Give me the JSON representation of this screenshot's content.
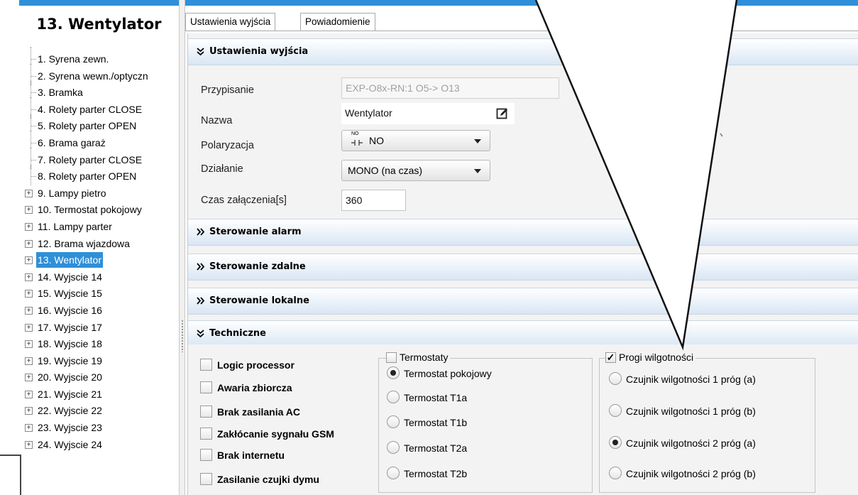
{
  "sidebar": {
    "title": "13. Wentylator",
    "items": [
      {
        "label": "1. Syrena zewn.",
        "expandable": false
      },
      {
        "label": "2. Syrena wewn./optyczn",
        "expandable": false
      },
      {
        "label": "3. Bramka",
        "expandable": false
      },
      {
        "label": "4. Rolety parter CLOSE",
        "expandable": false
      },
      {
        "label": "5. Rolety parter OPEN",
        "expandable": false
      },
      {
        "label": "6. Brama garaż",
        "expandable": false
      },
      {
        "label": "7. Rolety parter CLOSE",
        "expandable": false
      },
      {
        "label": "8. Rolety parter OPEN",
        "expandable": false
      },
      {
        "label": "9. Lampy pietro",
        "expandable": true
      },
      {
        "label": "10. Termostat pokojowy",
        "expandable": true
      },
      {
        "label": "11. Lampy parter",
        "expandable": true
      },
      {
        "label": "12. Brama wjazdowa",
        "expandable": true
      },
      {
        "label": "13. Wentylator",
        "expandable": true,
        "selected": true
      },
      {
        "label": "14. Wyjscie 14",
        "expandable": true
      },
      {
        "label": "15. Wyjscie 15",
        "expandable": true
      },
      {
        "label": "16. Wyjscie 16",
        "expandable": true
      },
      {
        "label": "17. Wyjscie 17",
        "expandable": true
      },
      {
        "label": "18. Wyjscie 18",
        "expandable": true
      },
      {
        "label": "19. Wyjscie 19",
        "expandable": true
      },
      {
        "label": "20. Wyjscie 20",
        "expandable": true
      },
      {
        "label": "21. Wyjscie 21",
        "expandable": true
      },
      {
        "label": "22. Wyjscie 22",
        "expandable": true
      },
      {
        "label": "23. Wyjscie 23",
        "expandable": true
      },
      {
        "label": "24. Wyjscie 24",
        "expandable": true
      }
    ],
    "expander_symbol": "+"
  },
  "tabs": [
    {
      "label": "Ustawienia wyjścia",
      "active": true
    },
    {
      "label": "Powiadomienie",
      "active": false
    }
  ],
  "sections": {
    "output_settings": {
      "chevron": "»",
      "chevron_open": "¥",
      "title": "Ustawienia wyjścia"
    },
    "alarm": {
      "chevron": "»",
      "title": "Sterowanie alarm"
    },
    "remote": {
      "chevron": "»",
      "title": "Sterowanie zdalne"
    },
    "local": {
      "chevron": "»",
      "title": "Sterowanie lokalne"
    },
    "technical": {
      "chevron": "¥",
      "title": "Techniczne"
    }
  },
  "form": {
    "assignment_label": "Przypisanie",
    "assignment_value": "EXP-O8x-RN:1 O5-> O13",
    "name_label": "Nazwa",
    "name_value": "Wentylator",
    "polarization_label": "Polaryzacja",
    "polarization_value": "NO",
    "polarization_icon_text": "NO",
    "action_label": "Działanie",
    "action_value": "MONO (na czas)",
    "on_time_label": "Czas załączenia[s]",
    "on_time_value": "360"
  },
  "technical": {
    "checkboxes": [
      {
        "label": "Logic processor",
        "checked": false
      },
      {
        "label": "Awaria zbiorcza",
        "checked": false
      },
      {
        "label": "Brak zasilania AC",
        "checked": false
      },
      {
        "label": "Zakłócanie sygnału GSM",
        "checked": false
      },
      {
        "label": "Brak internetu",
        "checked": false
      },
      {
        "label": "Zasilanie czujki dymu",
        "checked": false
      }
    ],
    "thermostats": {
      "legend": "Termostaty",
      "checked": false,
      "options": [
        {
          "label": "Termostat pokojowy",
          "selected": true
        },
        {
          "label": "Termostat T1a",
          "selected": false
        },
        {
          "label": "Termostat T1b",
          "selected": false
        },
        {
          "label": "Termostat T2a",
          "selected": false
        },
        {
          "label": "Termostat T2b",
          "selected": false
        }
      ]
    },
    "humidity": {
      "legend": "Progi wilgotności",
      "checked": true,
      "check_mark": "✓",
      "options": [
        {
          "label": "Czujnik  wilgotności 1 próg (a)",
          "selected": false
        },
        {
          "label": "Czujnik  wilgotności 1 próg (b)",
          "selected": false
        },
        {
          "label": "Czujnik  wilgotności 2 próg (a)",
          "selected": true
        },
        {
          "label": "Czujnik  wilgotności 2 próg (b)",
          "selected": false
        }
      ]
    }
  },
  "colors": {
    "accent": "#2f8fd8",
    "selected_bg": "#2f8fd8"
  },
  "icons": {
    "edit": "edit-icon",
    "polarization": "contact-no-icon",
    "dropdown": "chevron-down-icon"
  }
}
